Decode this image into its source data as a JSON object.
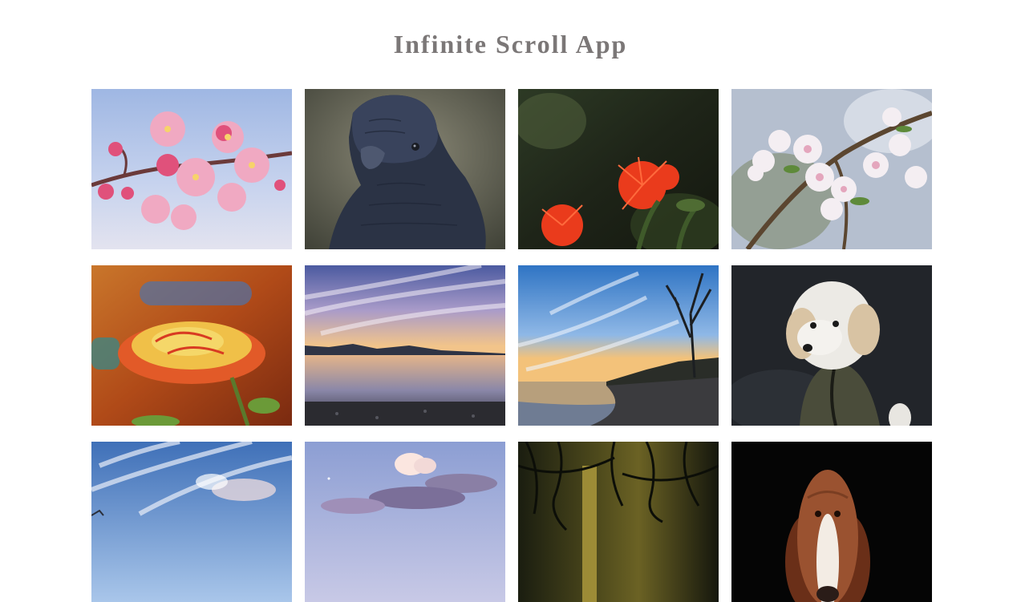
{
  "app": {
    "title": "Infinite Scroll App"
  },
  "gallery": {
    "photos": [
      {
        "subject": "pink cherry blossom branch"
      },
      {
        "subject": "black cockatoo"
      },
      {
        "subject": "red bottlebrush flowers"
      },
      {
        "subject": "white apple blossoms"
      },
      {
        "subject": "yellow red rose"
      },
      {
        "subject": "lake at sunset"
      },
      {
        "subject": "lakeshore with bare tree"
      },
      {
        "subject": "white dog in jacket"
      },
      {
        "subject": "blue sky clouds"
      },
      {
        "subject": "clouds at dusk"
      },
      {
        "subject": "dark forest vines"
      },
      {
        "subject": "basset hound"
      }
    ]
  }
}
